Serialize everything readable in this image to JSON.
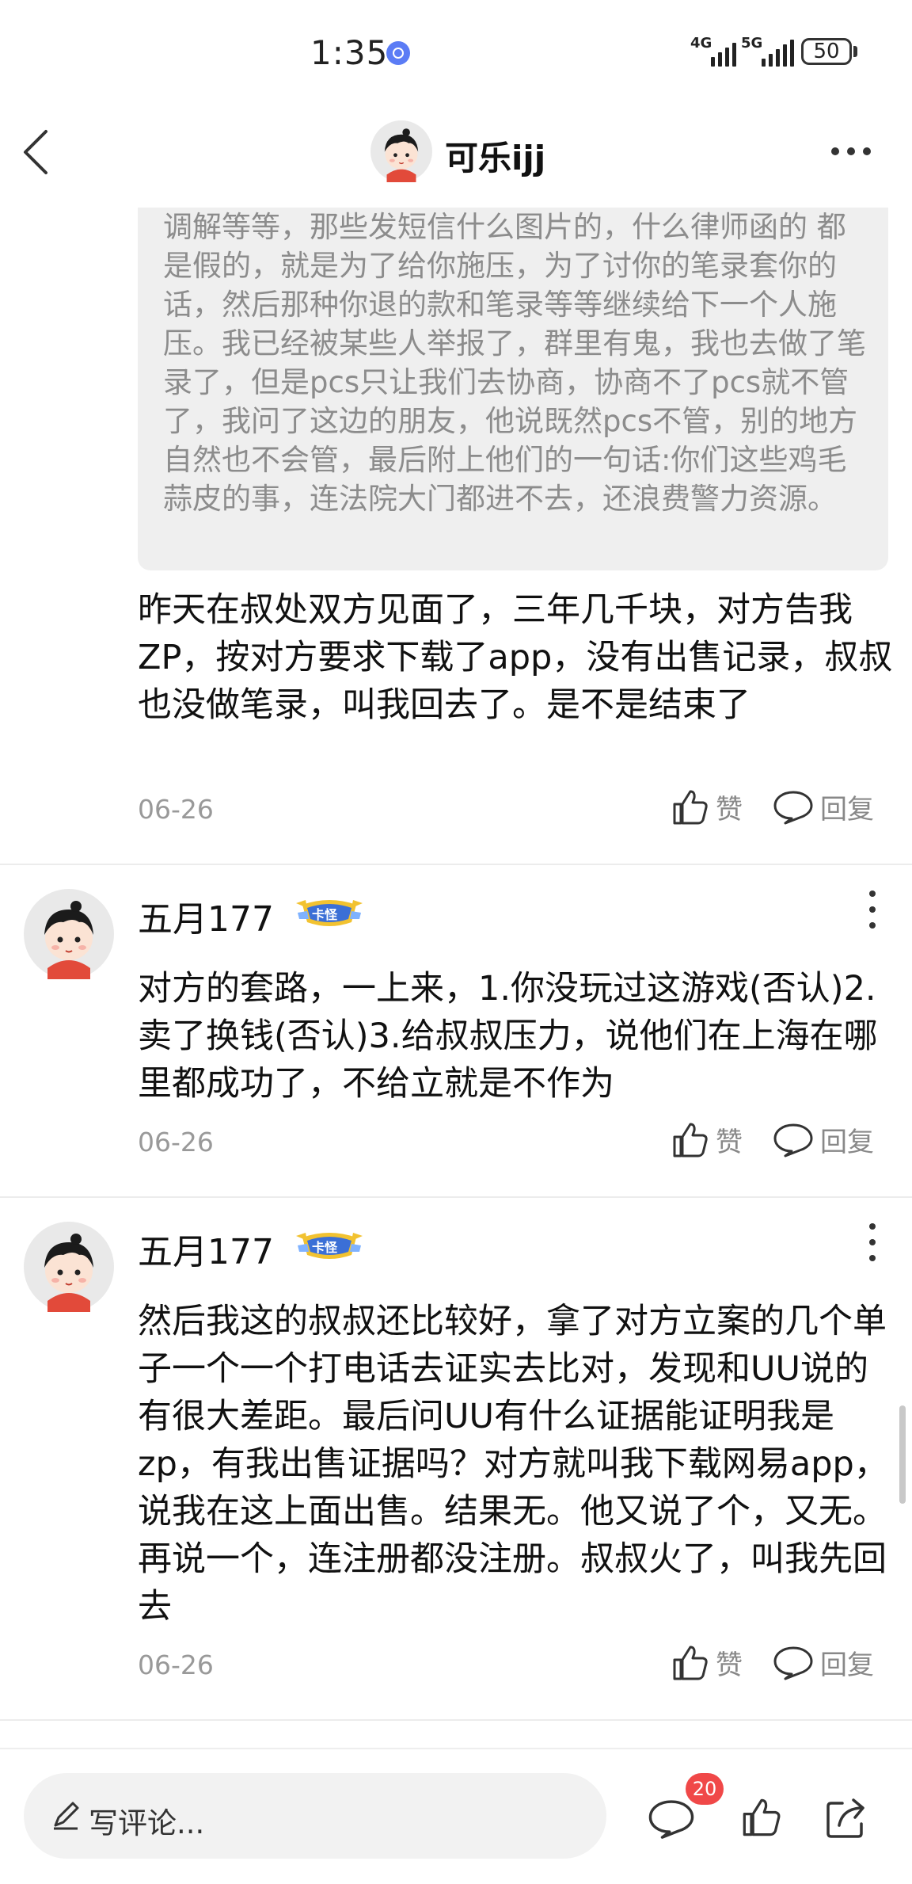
{
  "status_bar": {
    "time": "1:35",
    "network_1": "4G",
    "network_2": "5G",
    "battery": "50"
  },
  "header": {
    "title": "可乐ijj"
  },
  "quoted_post": {
    "text": "调解等等，那些发短信什么图片的，什么律师函的 都是假的，就是为了给你施压，为了讨你的笔录套你的话，然后那种你退的款和笔录等等继续给下一个人施压。我已经被某些人举报了，群里有鬼，我也去做了笔录了，但是pcs只让我们去协商，协商不了pcs就不管了，我问了这边的朋友，他说既然pcs不管，别的地方自然也不会管，最后附上他们的一句话:你们这些鸡毛蒜皮的事，连法院大门都进不去，还浪费警力资源。"
  },
  "comments": [
    {
      "text": "昨天在叔处双方见面了，三年几千块，对方告我ZP，按对方要求下载了app，没有出售记录，叔叔也没做笔录，叫我回去了。是不是结束了",
      "date": "06-26",
      "like_label": "赞",
      "reply_label": "回复"
    },
    {
      "username": "五月177",
      "badge": "卡怪",
      "text": "对方的套路，一上来，1.你没玩过这游戏(否认)2.卖了换钱(否认)3.给叔叔压力，说他们在上海在哪里都成功了，不给立就是不作为",
      "date": "06-26",
      "like_label": "赞",
      "reply_label": "回复"
    },
    {
      "username": "五月177",
      "badge": "卡怪",
      "text": "然后我这的叔叔还比较好，拿了对方立案的几个单子一个一个打电话去证实去比对，发现和UU说的有很大差距。最后问UU有什么证据能证明我是zp，有我出售证据吗？对方就叫我下载网易app，说我在这上面出售。结果无。他又说了个，又无。再说一个，连注册都没注册。叔叔火了，叫我先回去",
      "date": "06-26",
      "like_label": "赞",
      "reply_label": "回复"
    }
  ],
  "bottom_bar": {
    "input_placeholder": "写评论...",
    "comment_count": "20"
  },
  "icons": [
    "back-icon",
    "more-icon",
    "like-icon",
    "reply-icon",
    "kebab-icon",
    "pen-icon",
    "comment-icon",
    "share-icon"
  ],
  "colors": {
    "badge_red": "#f04848",
    "badge_blue": "#3b6fd6",
    "badge_gold": "#f2c230",
    "muted_text": "#999999"
  }
}
